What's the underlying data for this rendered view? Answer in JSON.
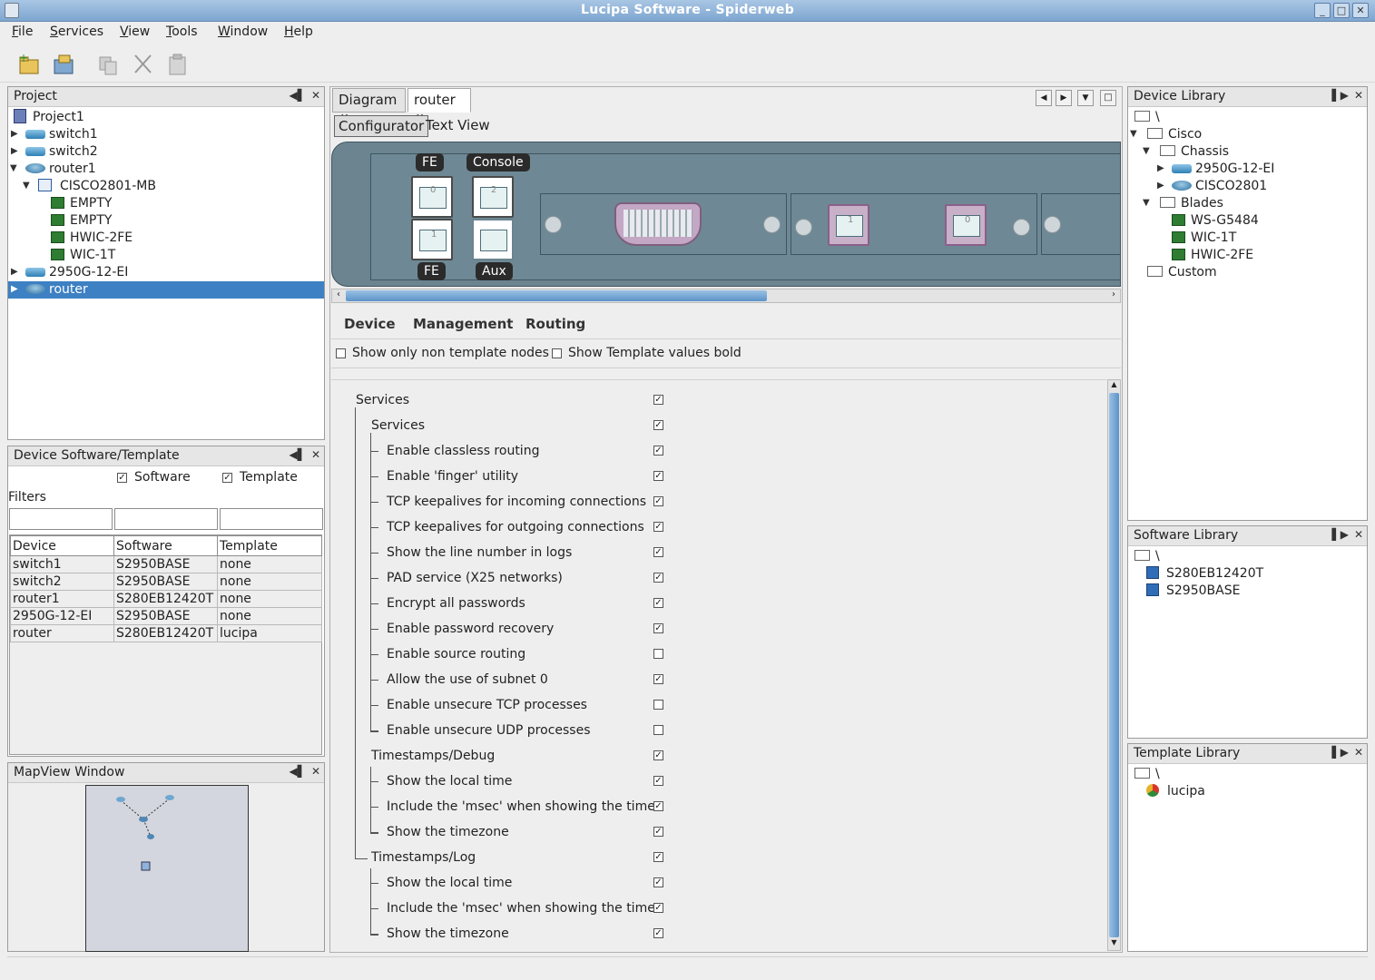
{
  "window": {
    "title": "Lucipa Software - Spiderweb"
  },
  "menu": [
    "File",
    "Services",
    "View",
    "Tools",
    "Window",
    "Help"
  ],
  "project": {
    "header": "Project",
    "items": [
      "Project1",
      "switch1",
      "switch2",
      "router1",
      "CISCO2801-MB",
      "EMPTY",
      "EMPTY",
      "HWIC-2FE",
      "WIC-1T",
      "2950G-12-EI",
      "router"
    ]
  },
  "software_template": {
    "header": "Device Software/Template",
    "software_label": "Software",
    "template_label": "Template",
    "filters_label": "Filters",
    "columns": [
      "Device",
      "Software",
      "Template"
    ],
    "rows": [
      [
        "switch1",
        "S2950BASE",
        "none"
      ],
      [
        "switch2",
        "S2950BASE",
        "none"
      ],
      [
        "router1",
        "S280EB12420T",
        "none"
      ],
      [
        "2950G-12-EI",
        "S2950BASE",
        "none"
      ],
      [
        "router",
        "S280EB12420T",
        "lucipa"
      ]
    ]
  },
  "mapview": {
    "header": "MapView Window"
  },
  "tabs": [
    "Diagram",
    "router"
  ],
  "subtabs": [
    "Configurator",
    "Text View"
  ],
  "ports": {
    "fe_top": "FE",
    "console": "Console",
    "fe_bottom": "FE",
    "aux": "Aux",
    "p0": "0",
    "p2": "2",
    "p1": "1",
    "wic1": "1",
    "wic0": "0"
  },
  "config_tabs": [
    "Device",
    "Management",
    "Routing"
  ],
  "options": {
    "non_template": "Show only non template nodes",
    "template_bold": "Show Template values bold"
  },
  "config": [
    {
      "label": "Services",
      "level": 0,
      "checked": true
    },
    {
      "label": "Services",
      "level": 1,
      "checked": true
    },
    {
      "label": "Enable classless routing",
      "level": 2,
      "checked": true
    },
    {
      "label": "Enable 'finger' utility",
      "level": 2,
      "checked": true
    },
    {
      "label": "TCP keepalives for incoming connections",
      "level": 2,
      "checked": true
    },
    {
      "label": "TCP keepalives for outgoing connections",
      "level": 2,
      "checked": true
    },
    {
      "label": "Show the line number in logs",
      "level": 2,
      "checked": true
    },
    {
      "label": "PAD service (X25 networks)",
      "level": 2,
      "checked": true
    },
    {
      "label": "Encrypt all passwords",
      "level": 2,
      "checked": true
    },
    {
      "label": "Enable password recovery",
      "level": 2,
      "checked": true
    },
    {
      "label": "Enable source routing",
      "level": 2,
      "checked": false
    },
    {
      "label": "Allow the use of subnet 0",
      "level": 2,
      "checked": true
    },
    {
      "label": "Enable unsecure TCP processes",
      "level": 2,
      "checked": false
    },
    {
      "label": "Enable unsecure UDP processes",
      "level": 2,
      "checked": false
    },
    {
      "label": "Timestamps/Debug",
      "level": 1,
      "checked": true
    },
    {
      "label": "Show the local time",
      "level": 2,
      "checked": true
    },
    {
      "label": "Include the 'msec' when showing the time",
      "level": 2,
      "checked": true
    },
    {
      "label": "Show the timezone",
      "level": 2,
      "checked": true
    },
    {
      "label": "Timestamps/Log",
      "level": 1,
      "checked": true
    },
    {
      "label": "Show the local time",
      "level": 2,
      "checked": true
    },
    {
      "label": "Include the 'msec' when showing the time",
      "level": 2,
      "checked": true
    },
    {
      "label": "Show the timezone",
      "level": 2,
      "checked": true
    }
  ],
  "device_library": {
    "header": "Device Library",
    "items": [
      "\\",
      "Cisco",
      "Chassis",
      "2950G-12-EI",
      "CISCO2801",
      "Blades",
      "WS-G5484",
      "WIC-1T",
      "HWIC-2FE",
      "Custom"
    ]
  },
  "software_library": {
    "header": "Software Library",
    "items": [
      "\\",
      "S280EB12420T",
      "S2950BASE"
    ]
  },
  "template_library": {
    "header": "Template Library",
    "items": [
      "\\",
      "lucipa"
    ]
  }
}
